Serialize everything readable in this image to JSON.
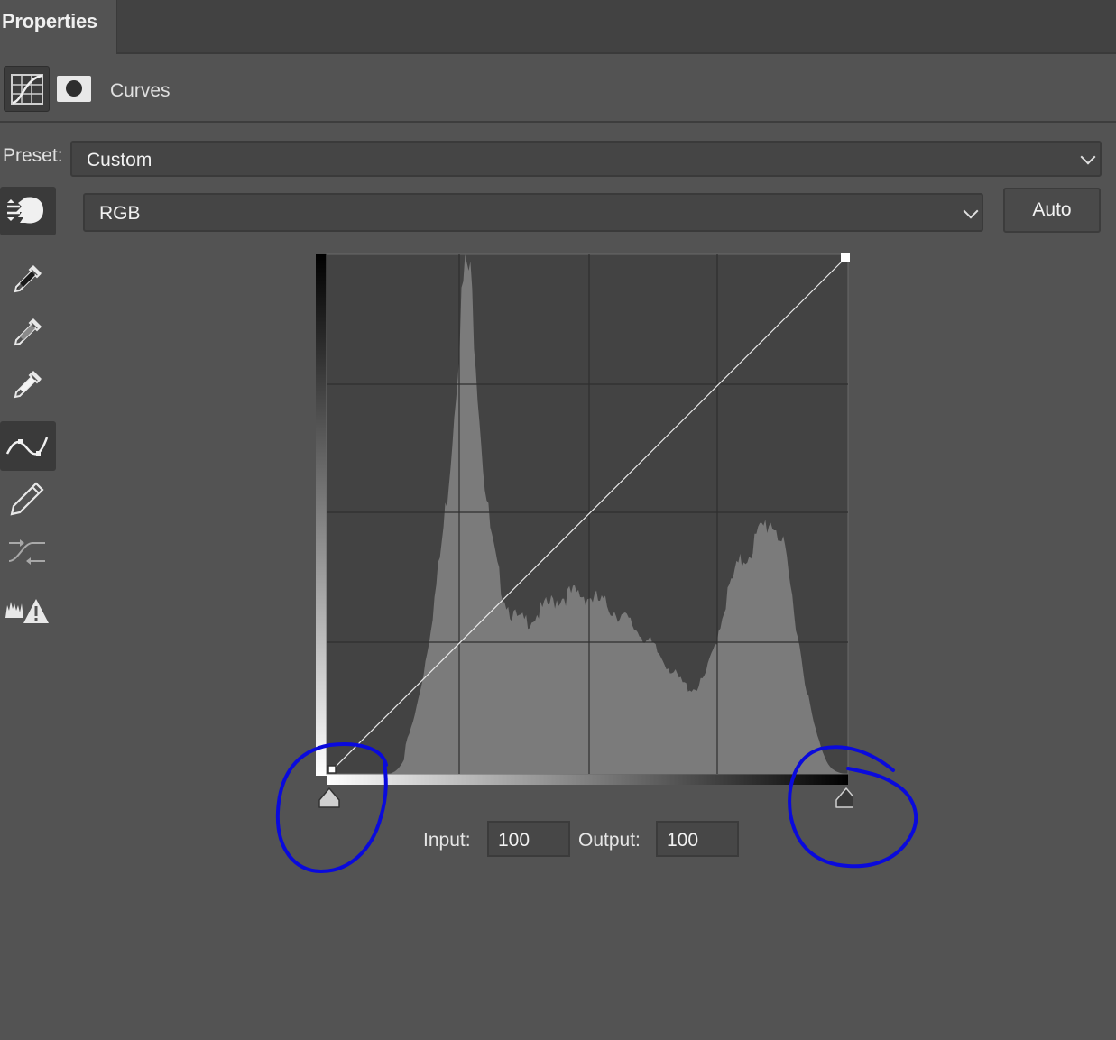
{
  "panel": {
    "tab_title": "Properties"
  },
  "adjustment": {
    "title": "Curves",
    "adjustment_icon": "curves-adjustment-icon",
    "mask_icon": "layer-mask-icon"
  },
  "preset": {
    "label": "Preset:",
    "value": "Custom"
  },
  "channel": {
    "value": "RGB"
  },
  "auto_button": {
    "label": "Auto"
  },
  "tools": [
    {
      "name": "on-image-adjustment-icon"
    },
    {
      "name": "black-point-eyedropper-icon"
    },
    {
      "name": "gray-point-eyedropper-icon"
    },
    {
      "name": "white-point-eyedropper-icon"
    },
    {
      "name": "curve-points-icon"
    },
    {
      "name": "pencil-icon"
    },
    {
      "name": "smooth-curve-icon"
    },
    {
      "name": "clipping-warning-icon"
    }
  ],
  "curve": {
    "start_point": {
      "input": 0,
      "output": 0
    },
    "end_point": {
      "input": 255,
      "output": 255
    }
  },
  "io": {
    "input_label": "Input:",
    "input_value": "100",
    "output_label": "Output:",
    "output_value": "100"
  },
  "annotations": {
    "color": "#0a0adc",
    "circles": [
      "black-point-slider",
      "white-point-slider"
    ]
  },
  "colors": {
    "panel_bg": "#535353",
    "graph_bg": "#434343",
    "histogram": "#7b7b7b"
  }
}
